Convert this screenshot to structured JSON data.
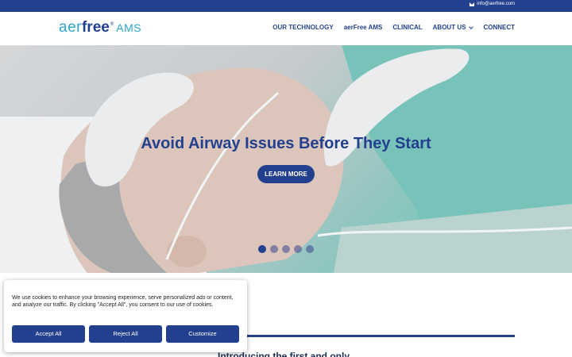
{
  "topbar": {
    "email": "info@aerfree.com",
    "email_icon": "envelope-icon"
  },
  "header": {
    "logo": {
      "part1": "aer",
      "part2": "free",
      "reg": "®",
      "suffix": "AMS"
    },
    "nav": [
      {
        "label": "OUR TECHNOLOGY",
        "active": true
      },
      {
        "label": "aerFree AMS"
      },
      {
        "label": "CLINICAL"
      },
      {
        "label": "ABOUT US",
        "has_dropdown": true
      },
      {
        "label": "CONNECT"
      }
    ]
  },
  "hero": {
    "title": "Avoid Airway Issues Before They Start",
    "button": "LEARN MORE",
    "slides": 5,
    "active_slide": 1,
    "colors": {
      "accent": "#23408e"
    }
  },
  "section": {
    "intro": "Introducing the first and only"
  },
  "cookie": {
    "text": "We use cookies to enhance your browsing experience, serve personalized ads or content, and analyze our traffic. By clicking \"Accept All\", you consent to our use of cookies.",
    "accept": "Accept All",
    "reject": "Reject All",
    "customize": "Customize"
  }
}
